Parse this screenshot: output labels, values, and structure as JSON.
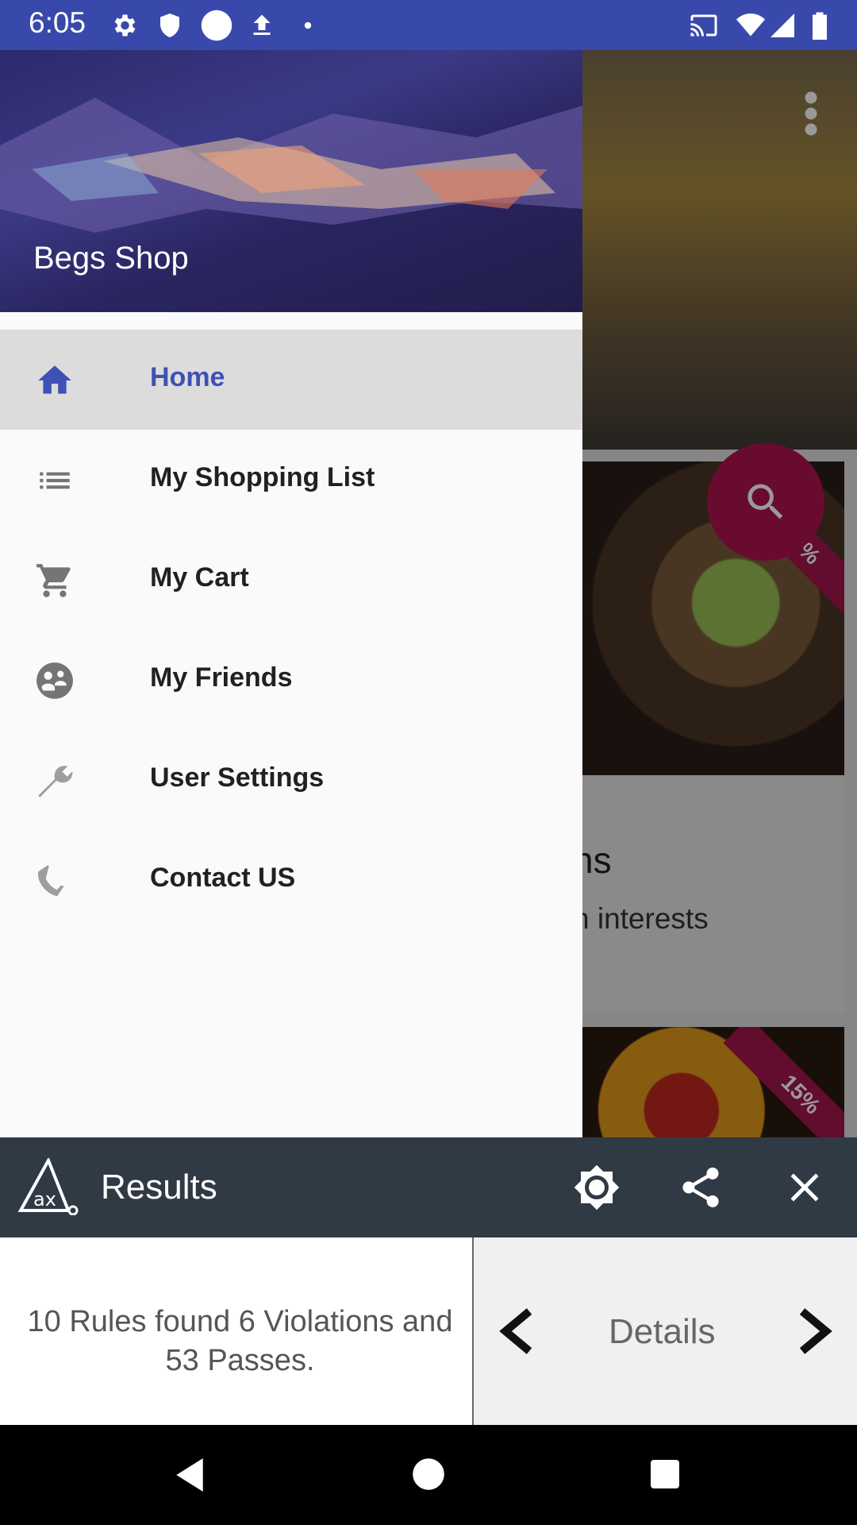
{
  "status_bar": {
    "time": "6:05"
  },
  "background_app": {
    "card1_title_fragment": "ns",
    "card1_subtitle_fragment": "n interests",
    "card1_ribbon": "10%",
    "card2_ribbon": "15%"
  },
  "drawer": {
    "shop_name": "Begs Shop",
    "items": [
      {
        "label": "Home",
        "icon": "home-icon",
        "active": true
      },
      {
        "label": "My Shopping List",
        "icon": "list-icon",
        "active": false
      },
      {
        "label": "My Cart",
        "icon": "cart-icon",
        "active": false
      },
      {
        "label": "My Friends",
        "icon": "friends-icon",
        "active": false
      },
      {
        "label": "User Settings",
        "icon": "wrench-icon",
        "active": false
      },
      {
        "label": "Contact US",
        "icon": "phone-icon",
        "active": false
      }
    ]
  },
  "results": {
    "title": "Results",
    "summary": "10 Rules found 6 Violations and 53 Passes.",
    "details_label": "Details"
  },
  "colors": {
    "status_bar": "#3949ab",
    "accent": "#3f51b5",
    "toolbar": "#2f3a45",
    "fab": "#b0134e"
  }
}
